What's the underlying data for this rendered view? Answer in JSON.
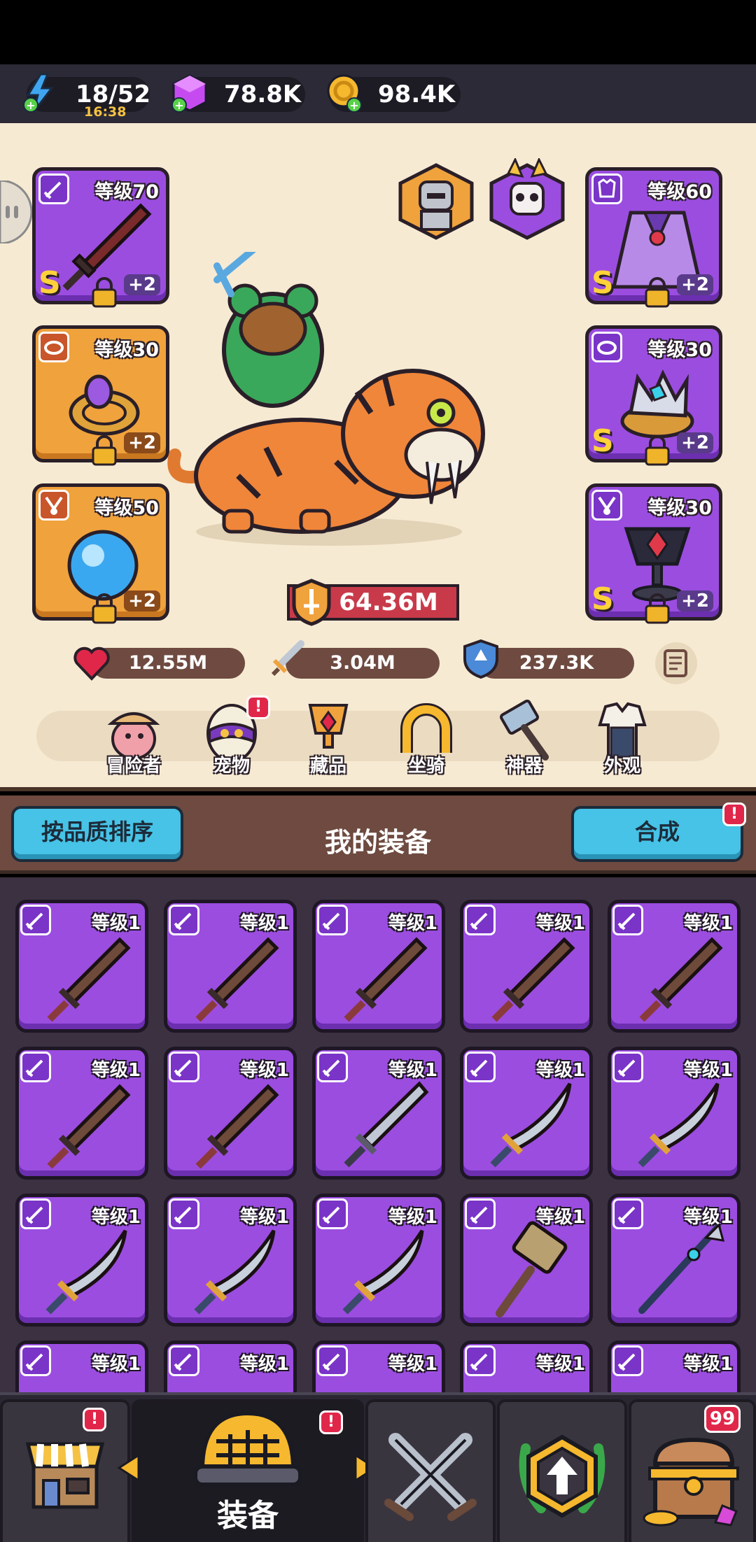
{
  "resources": {
    "energy": "18/52",
    "energy_timer": "16:38",
    "gems": "78.8K",
    "gold": "98.4K"
  },
  "equipped": {
    "left": [
      {
        "level": "等级70",
        "rank": "S",
        "plus": "+2",
        "color": "purple",
        "kind": "sword"
      },
      {
        "level": "等级30",
        "rank": "",
        "plus": "+2",
        "color": "orange",
        "kind": "ring"
      },
      {
        "level": "等级50",
        "rank": "",
        "plus": "+2",
        "color": "orange",
        "kind": "orb"
      }
    ],
    "right": [
      {
        "level": "等级60",
        "rank": "S",
        "plus": "+2",
        "color": "purple",
        "kind": "cape"
      },
      {
        "level": "等级30",
        "rank": "S",
        "plus": "+2",
        "color": "purple",
        "kind": "crown"
      },
      {
        "level": "等级30",
        "rank": "S",
        "plus": "+2",
        "color": "purple",
        "kind": "chalice"
      }
    ]
  },
  "power": "64.36M",
  "stats": {
    "hp": "12.55M",
    "attack": "3.04M",
    "defense": "237.3K"
  },
  "nav": [
    {
      "label": "冒险者",
      "badge": ""
    },
    {
      "label": "宠物",
      "badge": "!"
    },
    {
      "label": "藏品",
      "badge": ""
    },
    {
      "label": "坐骑",
      "badge": ""
    },
    {
      "label": "神器",
      "badge": ""
    },
    {
      "label": "外观",
      "badge": ""
    }
  ],
  "equipment": {
    "sort_label": "按品质排序",
    "title": "我的装备",
    "merge_label": "合成",
    "merge_badge": "!"
  },
  "inventory": [
    {
      "level": "等级1",
      "kind": "wood-sword"
    },
    {
      "level": "等级1",
      "kind": "wood-sword"
    },
    {
      "level": "等级1",
      "kind": "wood-sword"
    },
    {
      "level": "等级1",
      "kind": "wood-sword"
    },
    {
      "level": "等级1",
      "kind": "wood-sword"
    },
    {
      "level": "等级1",
      "kind": "wood-sword"
    },
    {
      "level": "等级1",
      "kind": "wood-sword"
    },
    {
      "level": "等级1",
      "kind": "steel-sword"
    },
    {
      "level": "等级1",
      "kind": "scimitar"
    },
    {
      "level": "等级1",
      "kind": "scimitar"
    },
    {
      "level": "等级1",
      "kind": "scimitar"
    },
    {
      "level": "等级1",
      "kind": "scimitar"
    },
    {
      "level": "等级1",
      "kind": "scimitar"
    },
    {
      "level": "等级1",
      "kind": "hammer"
    },
    {
      "level": "等级1",
      "kind": "spear"
    },
    {
      "level": "等级1",
      "kind": "partial"
    },
    {
      "level": "等级1",
      "kind": "partial"
    },
    {
      "level": "等级1",
      "kind": "partial"
    },
    {
      "level": "等级1",
      "kind": "partial"
    },
    {
      "level": "等级1",
      "kind": "partial"
    }
  ],
  "bottom_tabs": {
    "shop_badge": "!",
    "equip_label": "装备",
    "equip_badge": "!",
    "chest_badge": "99"
  },
  "colors": {
    "purple_slot": "#9b4de0",
    "orange_slot": "#f0a23c",
    "accent_blue": "#46c3e6",
    "badge_red": "#e0274a"
  }
}
